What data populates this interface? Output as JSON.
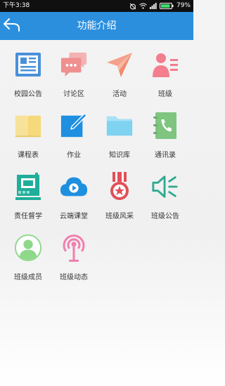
{
  "status_bar": {
    "time": "下午3:38",
    "battery": "79%"
  },
  "header": {
    "title": "功能介绍",
    "back_icon": "back-arrow-icon"
  },
  "tiles": [
    {
      "label": "校园公告",
      "icon": "newspaper-icon",
      "color": "#4a90d9"
    },
    {
      "label": "讨论区",
      "icon": "chat-bubble-icon",
      "color": "#ef8f8f"
    },
    {
      "label": "活动",
      "icon": "paper-plane-icon",
      "color": "#f5a08a"
    },
    {
      "label": "班级",
      "icon": "class-person-icon",
      "color": "#f27e8e"
    },
    {
      "label": "课程表",
      "icon": "book-icon",
      "color": "#f7e29a"
    },
    {
      "label": "作业",
      "icon": "pencil-note-icon",
      "color": "#1f8fe0"
    },
    {
      "label": "知识库",
      "icon": "folder-icon",
      "color": "#7fd3f0"
    },
    {
      "label": "通讯录",
      "icon": "phone-book-icon",
      "color": "#7fc47f"
    },
    {
      "label": "责任督学",
      "icon": "supervisor-chip-icon",
      "color": "#1fae9a"
    },
    {
      "label": "云端课堂",
      "icon": "cloud-play-icon",
      "color": "#1f8fe0"
    },
    {
      "label": "班级风采",
      "icon": "medal-icon",
      "color": "#e0505a"
    },
    {
      "label": "班级公告",
      "icon": "speaker-icon",
      "color": "#2faa8f"
    },
    {
      "label": "班级成员",
      "icon": "member-avatar-icon",
      "color": "#8fd88a"
    },
    {
      "label": "班级动态",
      "icon": "broadcast-icon",
      "color": "#f07fb0"
    }
  ]
}
